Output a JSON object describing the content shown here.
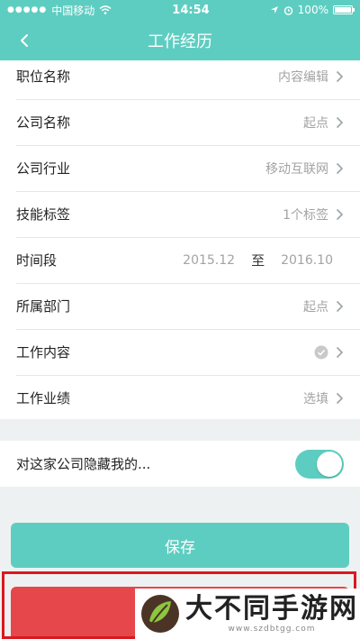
{
  "status_bar": {
    "carrier": "中国移动",
    "time": "14:54",
    "battery": "100%"
  },
  "nav": {
    "title": "工作经历"
  },
  "form": {
    "rows": [
      {
        "label": "职位名称",
        "value": "内容编辑"
      },
      {
        "label": "公司名称",
        "value": "起点"
      },
      {
        "label": "公司行业",
        "value": "移动互联网"
      },
      {
        "label": "技能标签",
        "value": "1个标签"
      },
      {
        "label": "所属部门",
        "value": "起点"
      },
      {
        "label": "工作内容",
        "value": ""
      },
      {
        "label": "工作业绩",
        "value": "选填"
      }
    ],
    "time_row": {
      "label": "时间段",
      "start": "2015.12",
      "separator": "至",
      "end": "2016.10"
    }
  },
  "hide_company": {
    "label": "对这家公司隐藏我的...",
    "enabled": true
  },
  "save_label": "保存",
  "watermark": {
    "text": "大不同手游网",
    "url": "www.szdbtgg.com"
  },
  "colors": {
    "accent": "#5ecdc1",
    "delete": "#e5474b",
    "highlight": "#d9191f"
  }
}
